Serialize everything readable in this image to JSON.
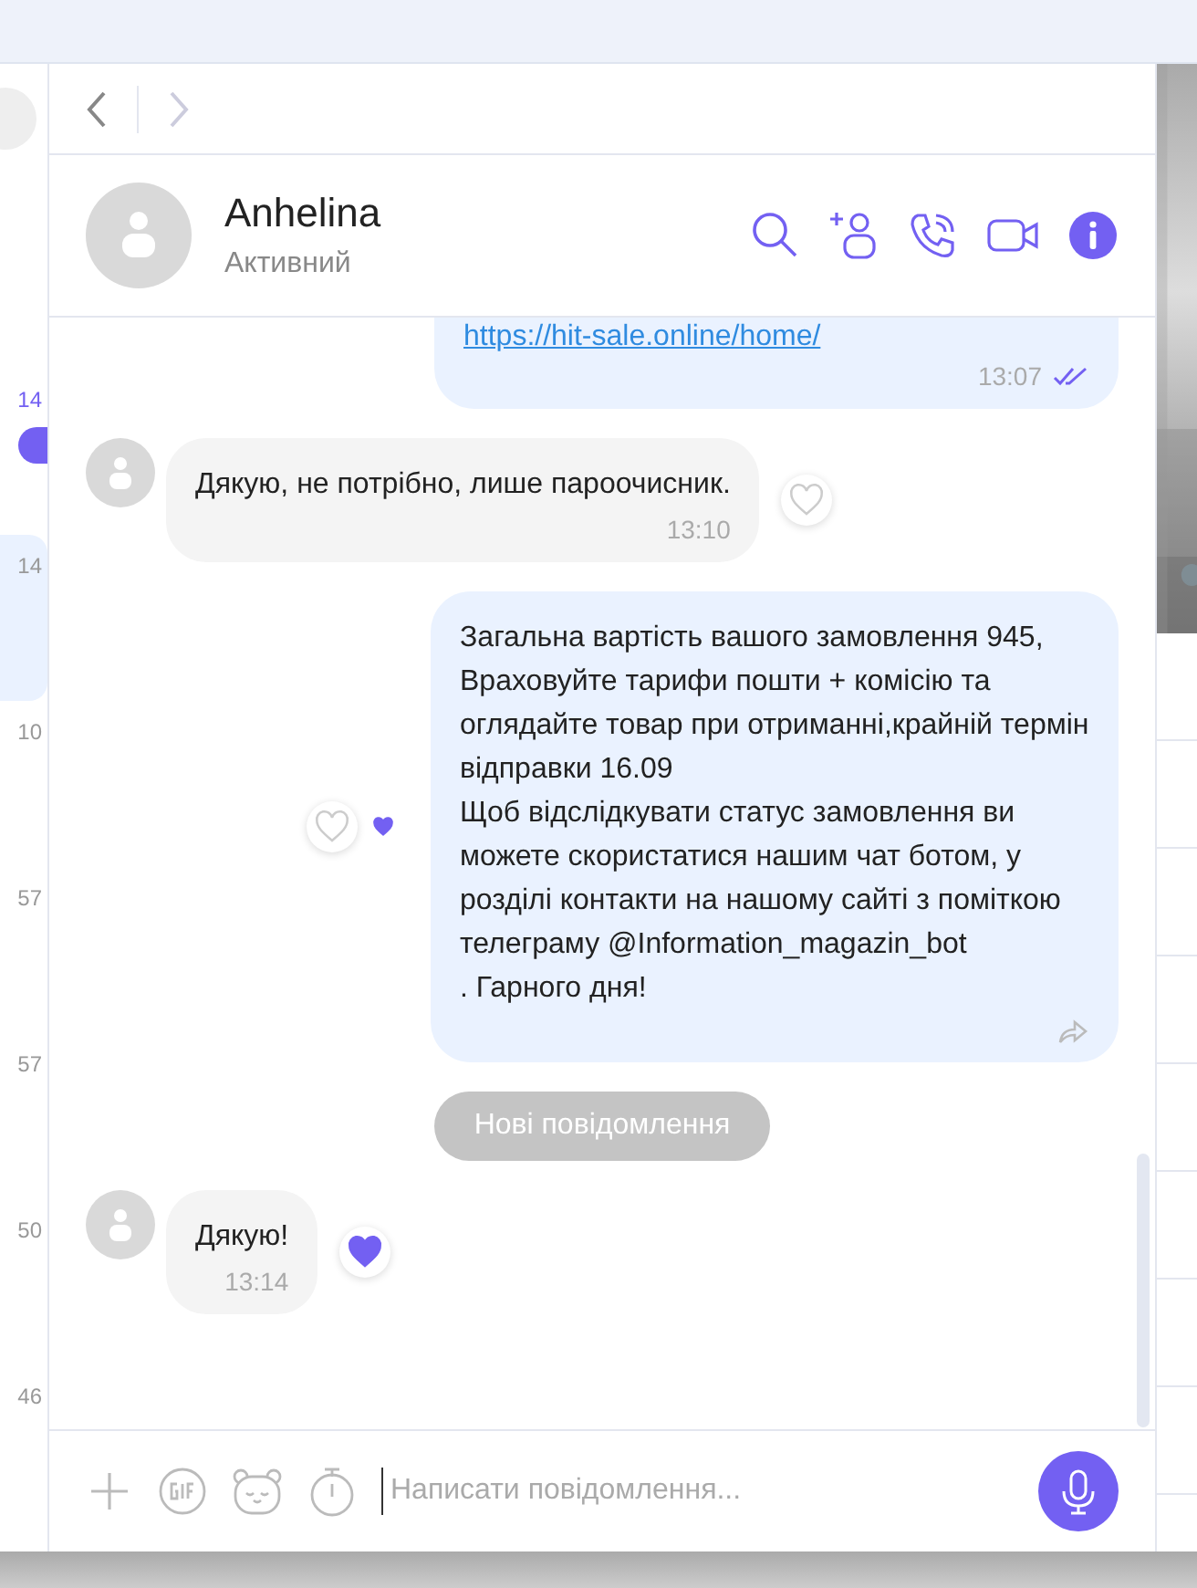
{
  "sidebar": {
    "items": [
      {
        "time": "14",
        "unread": true,
        "selected": false
      },
      {
        "time": "14",
        "unread": false,
        "selected": true
      },
      {
        "time": "10",
        "unread": false,
        "selected": false
      },
      {
        "time": "57",
        "unread": false,
        "selected": false
      },
      {
        "time": "57",
        "unread": false,
        "selected": false
      },
      {
        "time": "50",
        "unread": false,
        "selected": false
      },
      {
        "time": "46",
        "unread": false,
        "selected": false
      }
    ]
  },
  "contact": {
    "name": "Anhelina",
    "status": "Активний"
  },
  "messages": [
    {
      "kind": "outgoing",
      "link": "https://hit-sale.online/home/",
      "time": "13:07",
      "read": true
    },
    {
      "kind": "incoming",
      "text": "Дякую, не потрібно, лише пароочисник.",
      "time": "13:10",
      "reactions": [
        {
          "filled": false
        }
      ]
    },
    {
      "kind": "outgoing",
      "text": "Загальна вартість вашого замовлення 945, Враховуйте тарифи пошти + комісію  та оглядайте товар при отриманні,крайній термін відправки 16.09\nЩоб відслідкувати статус замовлення ви можете скористатися нашим чат ботом, у розділі контакти на нашому сайті з поміткою телеграму @Information_magazin_bot\n. Гарного дня!",
      "forwardable": true,
      "reactions": [
        {
          "filled": false
        },
        {
          "filled": true
        }
      ]
    },
    {
      "kind": "divider",
      "text": "Нові повідомлення"
    },
    {
      "kind": "incoming",
      "text": "Дякую!",
      "time": "13:14",
      "reactions": [
        {
          "filled": true
        }
      ]
    }
  ],
  "composer": {
    "placeholder": "Написати повідомлення..."
  }
}
